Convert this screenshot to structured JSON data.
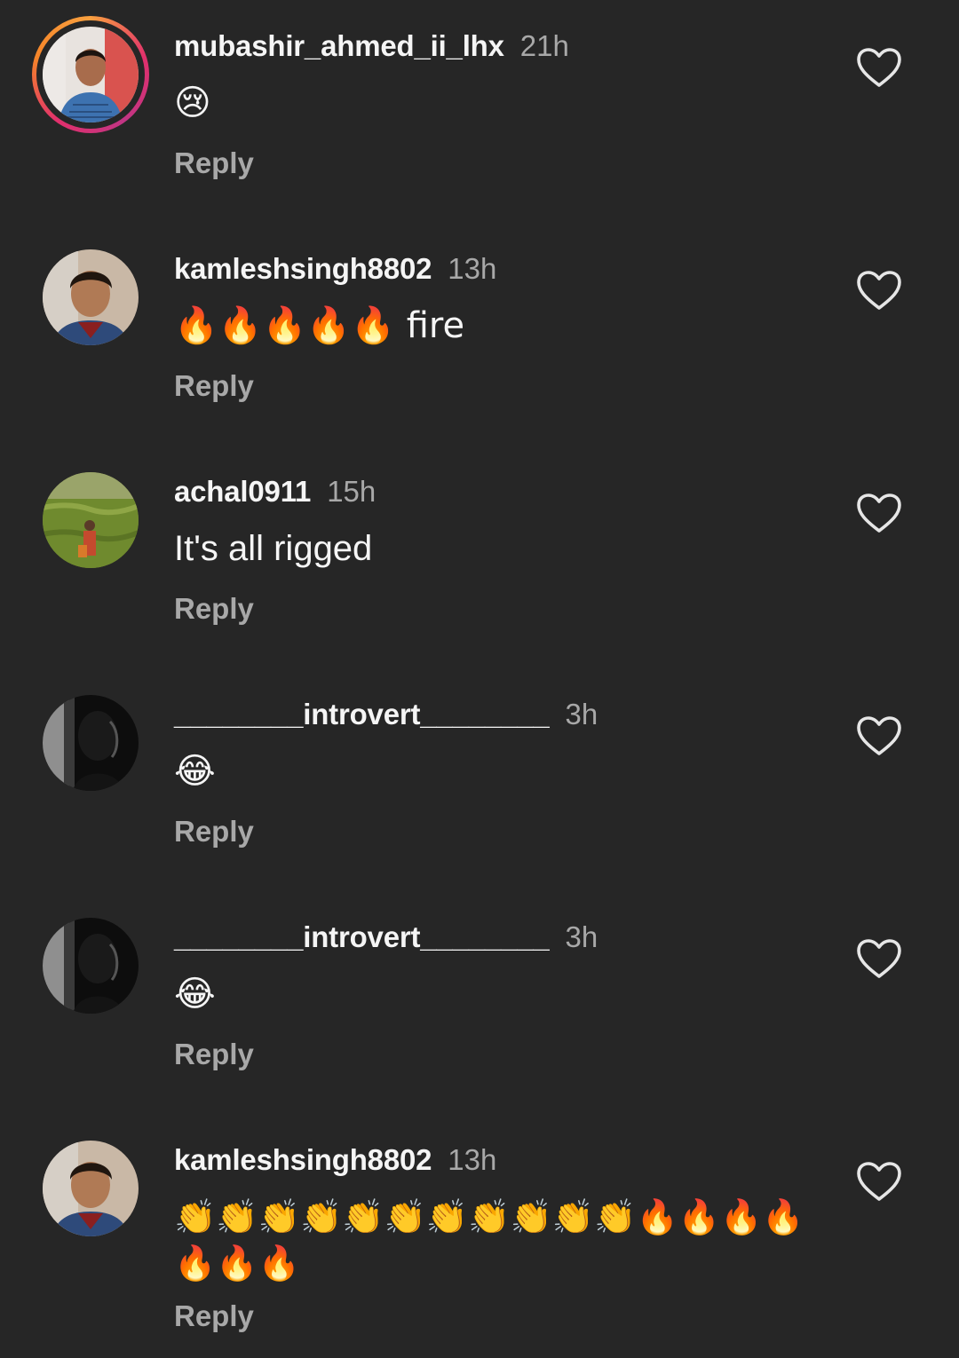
{
  "comments": [
    {
      "username": "mubashir_ahmed_ii_lhx",
      "time": "21h",
      "text": "😢",
      "reply_label": "Reply",
      "has_story_ring": true
    },
    {
      "username": "kamleshsingh8802",
      "time": "13h",
      "text": "🔥🔥🔥🔥🔥 fire",
      "reply_label": "Reply",
      "has_story_ring": false
    },
    {
      "username": "achal0911",
      "time": "15h",
      "text": "It's all rigged",
      "reply_label": "Reply",
      "has_story_ring": false
    },
    {
      "username": "________introvert________",
      "time": "3h",
      "text": "😂",
      "reply_label": "Reply",
      "has_story_ring": false
    },
    {
      "username": "________introvert________",
      "time": "3h",
      "text": "😂",
      "reply_label": "Reply",
      "has_story_ring": false
    },
    {
      "username": "kamleshsingh8802",
      "time": "13h",
      "text": "👏👏👏👏👏👏👏👏👏👏👏🔥🔥🔥🔥🔥🔥🔥",
      "reply_label": "Reply",
      "has_story_ring": false
    }
  ],
  "colors": {
    "background": "#262626",
    "text_primary": "#f5f5f5",
    "text_secondary": "#a8a8a8"
  },
  "icons": {
    "like": "heart-outline-icon"
  }
}
